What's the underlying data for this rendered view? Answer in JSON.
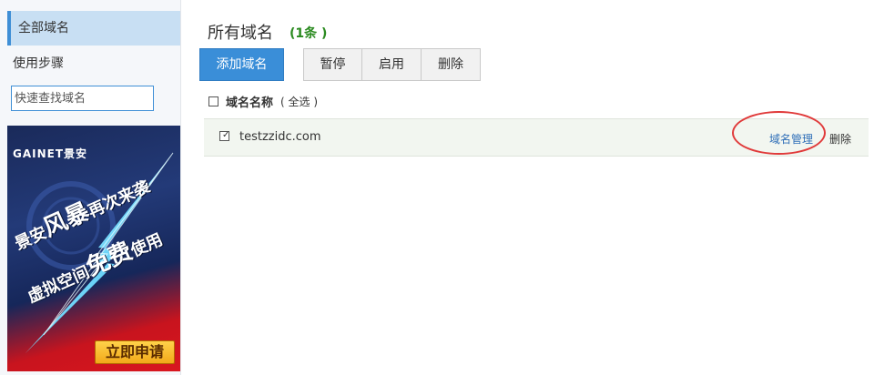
{
  "sidebar": {
    "all_domains": "全部域名",
    "steps": "使用步骤",
    "search_placeholder": "快速查找域名"
  },
  "ad": {
    "logo": "GAINET景安",
    "line1_a": "景安",
    "line1_big": "风暴",
    "line1_b": "再次来袭",
    "line2_a": "虚拟空间",
    "line2_big": "免费",
    "line2_b": "使用",
    "cta": "立即申请"
  },
  "main": {
    "title": "所有域名",
    "count": "(1条 )",
    "add_button": "添加域名",
    "actions": [
      "暂停",
      "启用",
      "删除"
    ],
    "header_label": "域名名称",
    "select_all": "( 全选 )",
    "rows": [
      {
        "domain": "testzzidc.com",
        "checked": true,
        "manage": "域名管理",
        "delete": "删除"
      }
    ]
  },
  "colors": {
    "accent_blue": "#3a8ed8",
    "count_green": "#2a8a1f",
    "highlight_red": "#e03a3a"
  }
}
